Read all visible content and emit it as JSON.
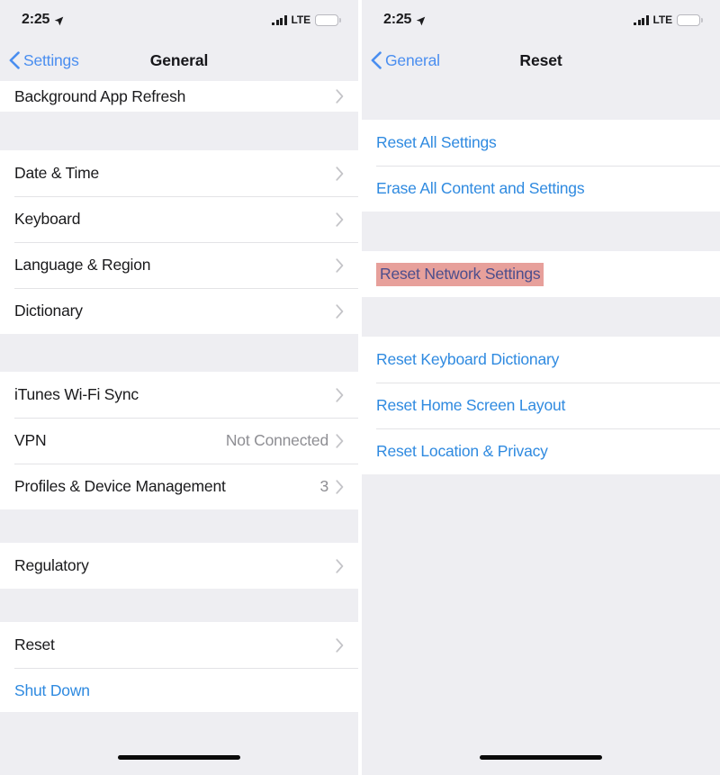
{
  "screens": [
    {
      "id": "general-settings",
      "status_bar": {
        "time": "2:25",
        "location_icon": "location-arrow-icon",
        "signal_icon": "cellular-signal-icon",
        "carrier_label": "LTE",
        "battery_icon": "battery-icon",
        "battery_color": "#f5c518",
        "battery_level_percent": 62
      },
      "nav": {
        "back_icon": "chevron-left-icon",
        "back_label": "Settings",
        "title": "General"
      },
      "sections": [
        {
          "name": "background-refresh-section",
          "partial": true,
          "rows": [
            {
              "label": "Background App Refresh",
              "accessory": "chevron",
              "value": "",
              "style": "default"
            }
          ]
        },
        {
          "name": "localization-section",
          "partial": false,
          "rows": [
            {
              "label": "Date & Time",
              "accessory": "chevron",
              "value": "",
              "style": "default"
            },
            {
              "label": "Keyboard",
              "accessory": "chevron",
              "value": "",
              "style": "default"
            },
            {
              "label": "Language & Region",
              "accessory": "chevron",
              "value": "",
              "style": "default"
            },
            {
              "label": "Dictionary",
              "accessory": "chevron",
              "value": "",
              "style": "default"
            }
          ]
        },
        {
          "name": "connectivity-section",
          "partial": false,
          "rows": [
            {
              "label": "iTunes Wi-Fi Sync",
              "accessory": "chevron",
              "value": "",
              "style": "default"
            },
            {
              "label": "VPN",
              "accessory": "chevron",
              "value": "Not Connected",
              "style": "default"
            },
            {
              "label": "Profiles & Device Management",
              "accessory": "chevron",
              "value": "3",
              "style": "default"
            }
          ]
        },
        {
          "name": "regulatory-section",
          "partial": false,
          "rows": [
            {
              "label": "Regulatory",
              "accessory": "chevron",
              "value": "",
              "style": "default"
            }
          ]
        },
        {
          "name": "reset-section",
          "partial": false,
          "rows": [
            {
              "label": "Reset",
              "accessory": "chevron",
              "value": "",
              "style": "default"
            },
            {
              "label": "Shut Down",
              "accessory": "none",
              "value": "",
              "style": "link"
            }
          ]
        }
      ]
    },
    {
      "id": "reset-settings",
      "status_bar": {
        "time": "2:25",
        "location_icon": "location-arrow-icon",
        "signal_icon": "cellular-signal-icon",
        "carrier_label": "LTE",
        "battery_icon": "battery-icon",
        "battery_color": "#f5c518",
        "battery_level_percent": 62
      },
      "nav": {
        "back_icon": "chevron-left-icon",
        "back_label": "General",
        "title": "Reset"
      },
      "sections": [
        {
          "name": "reset-all-section",
          "partial": false,
          "rows": [
            {
              "label": "Reset All Settings",
              "accessory": "none",
              "value": "",
              "style": "link"
            },
            {
              "label": "Erase All Content and Settings",
              "accessory": "none",
              "value": "",
              "style": "link"
            }
          ]
        },
        {
          "name": "reset-network-section",
          "partial": false,
          "rows": [
            {
              "label": "Reset Network Settings",
              "accessory": "none",
              "value": "",
              "style": "highlight"
            }
          ]
        },
        {
          "name": "reset-other-section",
          "partial": false,
          "rows": [
            {
              "label": "Reset Keyboard Dictionary",
              "accessory": "none",
              "value": "",
              "style": "link"
            },
            {
              "label": "Reset Home Screen Layout",
              "accessory": "none",
              "value": "",
              "style": "link"
            },
            {
              "label": "Reset Location & Privacy",
              "accessory": "none",
              "value": "",
              "style": "link"
            }
          ]
        }
      ]
    }
  ],
  "colors": {
    "tint_blue": "#2f8ae0",
    "nav_blue": "#4a8ef0",
    "highlight_salmon": "#e7a09b",
    "highlight_text": "#4c4e8c",
    "group_background": "#eeeef2",
    "row_background": "#ffffff",
    "separator": "#e3e3e6",
    "secondary_text": "#8e8e93",
    "battery_yellow": "#f5c518"
  },
  "home_indicator": {
    "label": "home-indicator-bar"
  }
}
